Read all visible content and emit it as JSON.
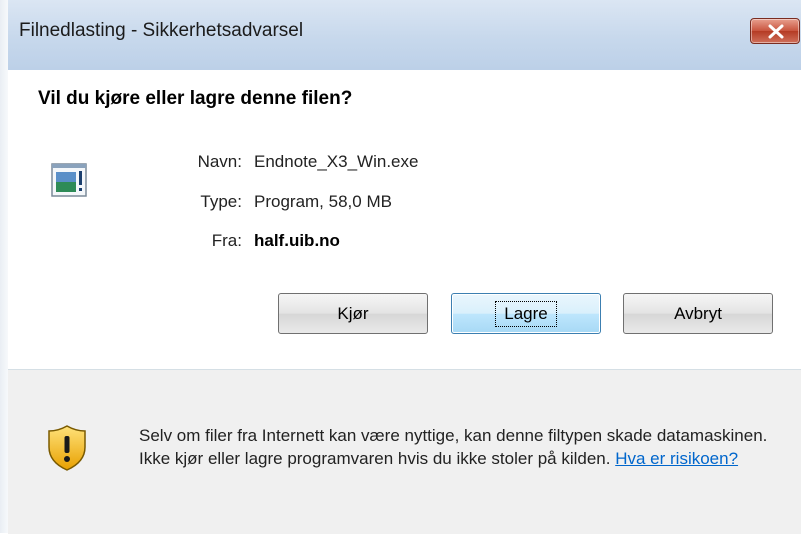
{
  "window": {
    "title": "Filnedlasting - Sikkerhetsadvarsel",
    "close_icon": "close-icon"
  },
  "dialog": {
    "question": "Vil du kjøre eller lagre denne filen?",
    "file_icon": "executable-file-icon",
    "fields": [
      {
        "label": "Navn:",
        "value": "Endnote_X3_Win.exe"
      },
      {
        "label": "Type:",
        "value": "Program, 58,0 MB"
      },
      {
        "label": "Fra:",
        "value": "half.uib.no"
      }
    ]
  },
  "buttons": {
    "run": "Kjør",
    "save": "Lagre",
    "cancel": "Avbryt"
  },
  "warning": {
    "icon": "security-shield-icon",
    "text": "Selv om filer fra Internett kan være nyttige, kan denne filtypen skade datamaskinen. Ikke kjør eller lagre programvaren hvis du ikke stoler på kilden.",
    "link": "Hva er risikoen?"
  },
  "colors": {
    "titlebar": "#c7d8ec",
    "close_button": "#c8533d",
    "default_button": "#bee6fd",
    "link": "#0066cc",
    "footer_bg": "#f0f0f0"
  }
}
